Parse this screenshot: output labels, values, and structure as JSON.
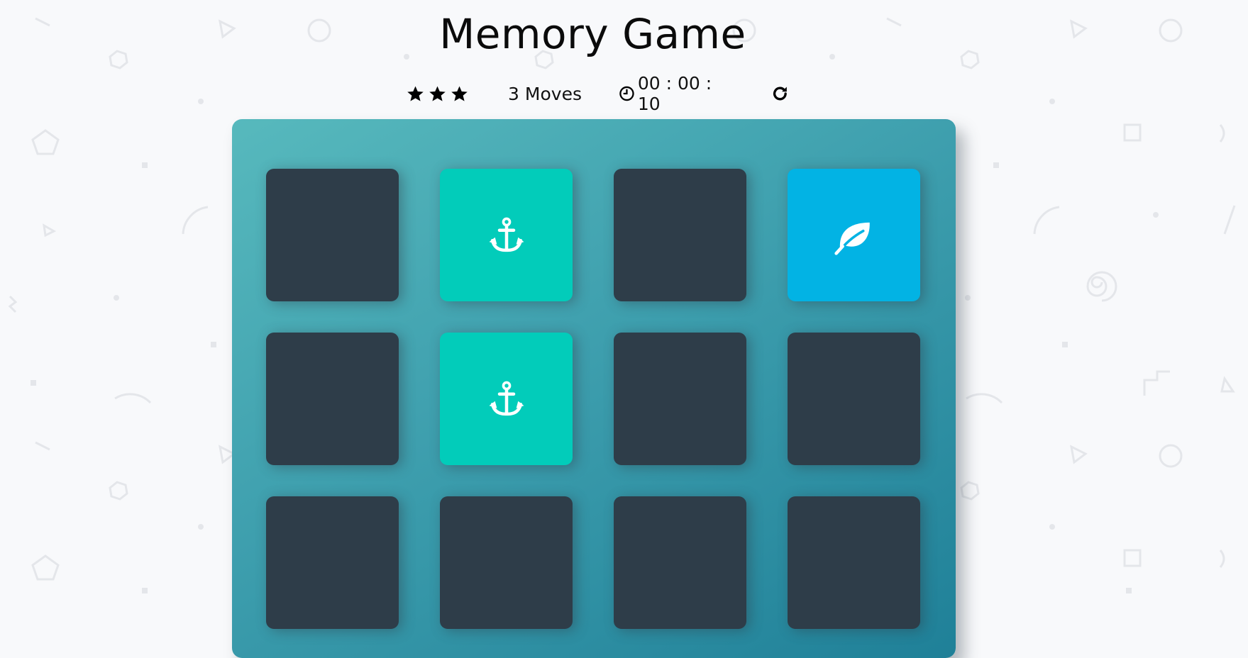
{
  "title": "Memory Game",
  "score_panel": {
    "stars_filled": 3,
    "stars_total": 3,
    "moves_count": "3",
    "moves_label": "Moves",
    "timer": "00 : 00 : 10",
    "icons": {
      "star": "star-icon",
      "clock": "clock-icon",
      "restart": "restart-icon"
    }
  },
  "deck": {
    "columns": 4,
    "visible_rows": 3,
    "cards": [
      {
        "state": "closed",
        "icon": null
      },
      {
        "state": "match",
        "icon": "anchor-icon"
      },
      {
        "state": "closed",
        "icon": null
      },
      {
        "state": "open",
        "icon": "leaf-icon"
      },
      {
        "state": "closed",
        "icon": null
      },
      {
        "state": "match",
        "icon": "anchor-icon"
      },
      {
        "state": "closed",
        "icon": null
      },
      {
        "state": "closed",
        "icon": null
      },
      {
        "state": "closed",
        "icon": null
      },
      {
        "state": "closed",
        "icon": null
      },
      {
        "state": "closed",
        "icon": null
      },
      {
        "state": "closed",
        "icon": null
      }
    ]
  },
  "colors": {
    "card_closed": "#2e3d49",
    "card_match": "#02ccba",
    "card_open": "#02b3e4",
    "deck_gradient_start": "#57b9bd",
    "deck_gradient_end": "#1f8098",
    "background": "#f8f9fb"
  }
}
